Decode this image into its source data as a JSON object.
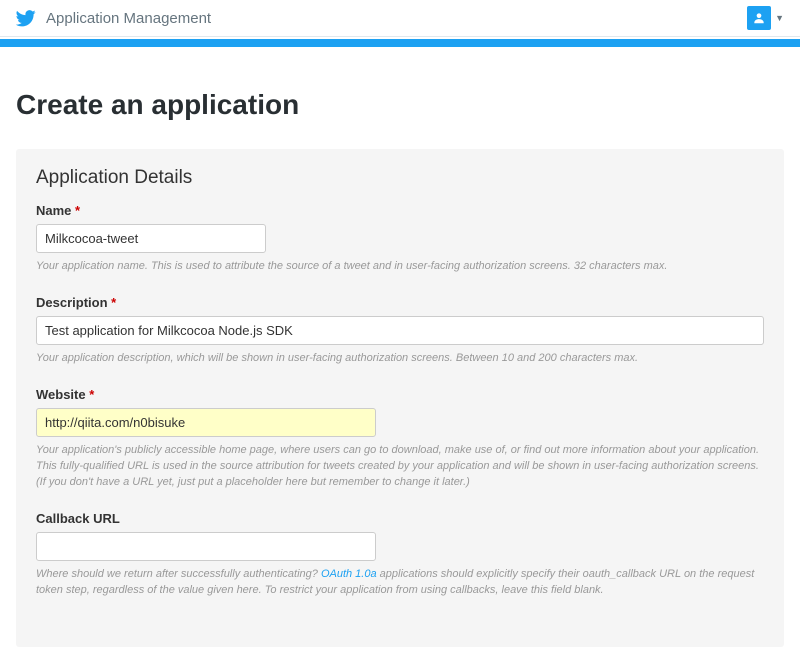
{
  "header": {
    "title": "Application Management"
  },
  "page_title": "Create an application",
  "panel": {
    "heading": "Application Details"
  },
  "form": {
    "name": {
      "label": "Name",
      "value": "Milkcocoa-tweet",
      "help": "Your application name. This is used to attribute the source of a tweet and in user-facing authorization screens. 32 characters max."
    },
    "description": {
      "label": "Description",
      "value": "Test application for Milkcocoa Node.js SDK",
      "help": "Your application description, which will be shown in user-facing authorization screens. Between 10 and 200 characters max."
    },
    "website": {
      "label": "Website",
      "value": "http://qiita.com/n0bisuke",
      "help1": "Your application's publicly accessible home page, where users can go to download, make use of, or find out more information about your application. This fully-qualified URL is used in the source attribution for tweets created by your application and will be shown in user-facing authorization screens.",
      "help2": "(If you don't have a URL yet, just put a placeholder here but remember to change it later.)"
    },
    "callback": {
      "label": "Callback URL",
      "value": "",
      "help_pre": "Where should we return after successfully authenticating? ",
      "help_link": "OAuth 1.0a",
      "help_post": " applications should explicitly specify their oauth_callback URL on the request token step, regardless of the value given here. To restrict your application from using callbacks, leave this field blank."
    }
  }
}
